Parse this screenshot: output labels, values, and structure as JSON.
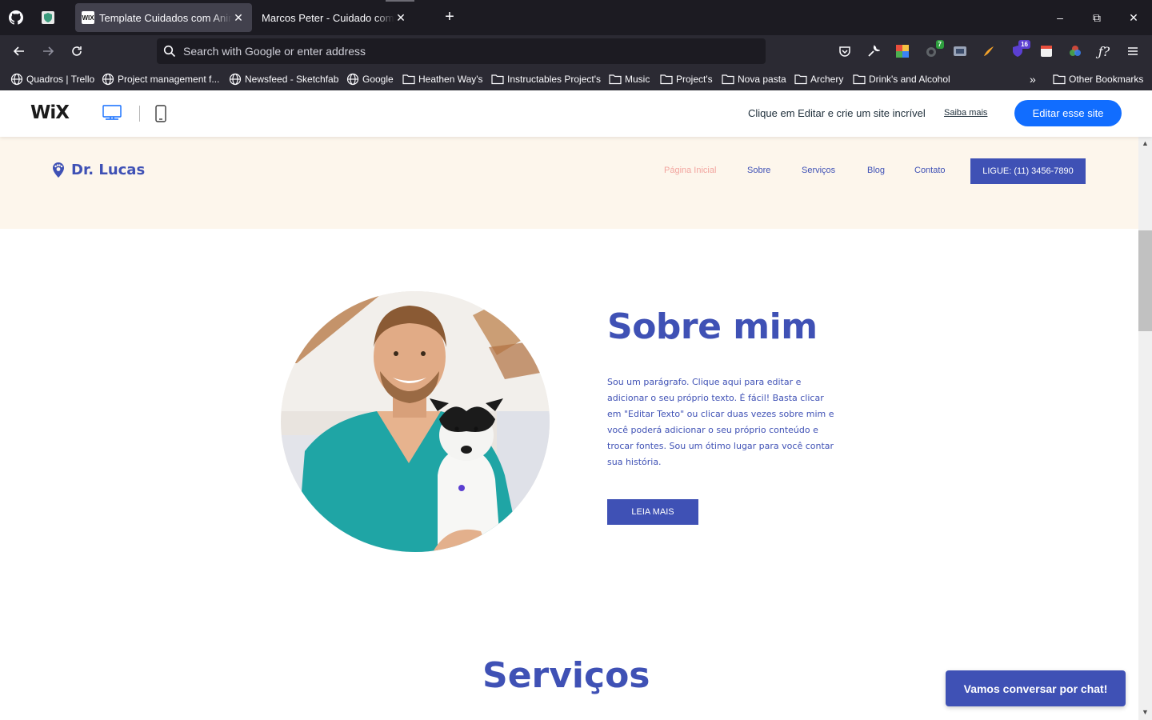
{
  "browser": {
    "tabs": [
      {
        "title": "Template Cuidados com Animais",
        "favicon": "WIX",
        "active": true
      },
      {
        "title": "Marcos Peter - Cuidado com Animais",
        "active": false
      }
    ],
    "new_tab": "+",
    "window": {
      "minimize": "–",
      "restore": "⧉",
      "close": "✕"
    },
    "address_placeholder": "Search with Google or enter address",
    "extension_badges": {
      "first": "7",
      "second": "16"
    },
    "bookmarks": [
      {
        "label": "Quadros | Trello",
        "type": "globe"
      },
      {
        "label": "Project management f...",
        "type": "globe"
      },
      {
        "label": "Newsfeed - Sketchfab",
        "type": "globe"
      },
      {
        "label": "Google",
        "type": "globe"
      },
      {
        "label": "Heathen Way's",
        "type": "folder"
      },
      {
        "label": "Instructables Project's",
        "type": "folder"
      },
      {
        "label": "Music",
        "type": "folder"
      },
      {
        "label": "Project's",
        "type": "folder"
      },
      {
        "label": "Nova pasta",
        "type": "folder"
      },
      {
        "label": "Archery",
        "type": "folder"
      },
      {
        "label": "Drink's and Alcohol",
        "type": "folder"
      }
    ],
    "other_bookmarks": "Other Bookmarks"
  },
  "wix_bar": {
    "logo": "WiX",
    "message": "Clique em Editar e crie um site incrível",
    "learn_more": "Saiba mais",
    "edit_button": "Editar esse site"
  },
  "site": {
    "brand": "Dr. Lucas",
    "menu": [
      "Página Inicial",
      "Sobre",
      "Serviços",
      "Blog",
      "Contato"
    ],
    "call_button": "LIGUE: (11) 3456-7890",
    "about": {
      "title": "Sobre mim",
      "text": "Sou um parágrafo. Clique aqui para editar e adicionar o seu próprio texto. É fácil! Basta clicar em \"Editar Texto\" ou clicar duas vezes sobre mim e você poderá adicionar o seu próprio conteúdo e trocar fontes. Sou um ótimo lugar para você contar sua história.",
      "button": "LEIA MAIS"
    },
    "services_title": "Serviços",
    "chat_button": "Vamos conversar por chat!"
  },
  "colors": {
    "brand_blue": "#3f51b5",
    "header_bg": "#fdf6ec",
    "active_menu": "#f2a59f",
    "wix_blue": "#116dff"
  }
}
